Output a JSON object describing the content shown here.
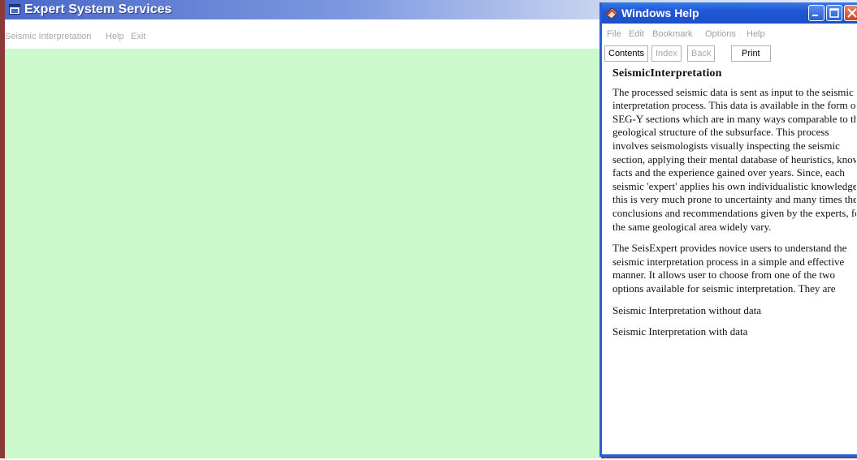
{
  "main_window": {
    "title": "Expert System Services",
    "menu": [
      "Seismic Interpretation",
      "Help",
      "Exit"
    ],
    "client_color": "#ccf9cc"
  },
  "help_window": {
    "title": "Windows Help",
    "menu": [
      "File",
      "Edit",
      "Bookmark",
      "Options",
      "Help"
    ],
    "toolbar": {
      "contents": "Contents",
      "index": "Index",
      "back": "Back",
      "print": "Print"
    },
    "topic_title": "SeismicInterpretation",
    "paragraphs": [
      "The processed seismic data is sent as input to the seismic interpretation process. This data is available in the form of SEG-Y sections which are in many ways comparable to the geological structure of the subsurface. This process involves seismologists visually inspecting the seismic section, applying their mental database of heuristics, known facts and the experience gained over years. Since, each seismic 'expert' applies his own individualistic knowledge, this is very much prone to uncertainty and many times the conclusions and recommendations given by the experts, for the same geological area widely vary.",
      "The SeisExpert provides novice users to understand the seismic interpretation process in a simple and effective manner. It allows user to choose from one of the two options available for seismic interpretation. They are",
      "Seismic Interpretation without data",
      "Seismic Interpretation with data"
    ]
  },
  "colors": {
    "main_title_gradient_start": "#4a68c8",
    "help_title": "#2158d6",
    "frame_border": "#8b3a3a"
  }
}
